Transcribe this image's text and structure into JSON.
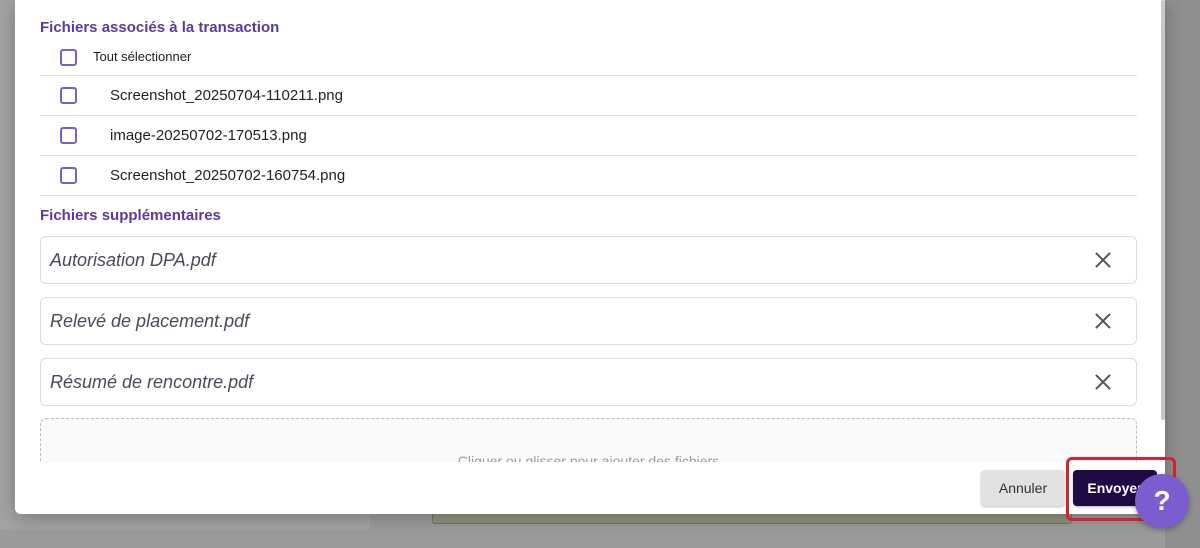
{
  "linked_files": {
    "title": "Fichiers associés à la transaction",
    "select_all_label": "Tout sélectionner",
    "items": [
      {
        "name": "Screenshot_20250704-110211.png"
      },
      {
        "name": "image-20250702-170513.png"
      },
      {
        "name": "Screenshot_20250702-160754.png"
      }
    ]
  },
  "extra_files": {
    "title": "Fichiers supplémentaires",
    "items": [
      {
        "name": "Autorisation DPA.pdf"
      },
      {
        "name": "Relevé de placement.pdf"
      },
      {
        "name": "Résumé de rencontre.pdf"
      }
    ],
    "dropzone_hint": "Cliquer ou glisser pour ajouter des fichiers"
  },
  "footer": {
    "cancel_label": "Annuler",
    "send_label": "Envoyer"
  },
  "help": {
    "label": "?"
  },
  "colors": {
    "accent": "#5b3b9a",
    "checkbox": "#7b5ec6",
    "primary_button": "#1e0b45",
    "highlight": "#d4242c",
    "help_bubble": "#7c5ccf"
  }
}
